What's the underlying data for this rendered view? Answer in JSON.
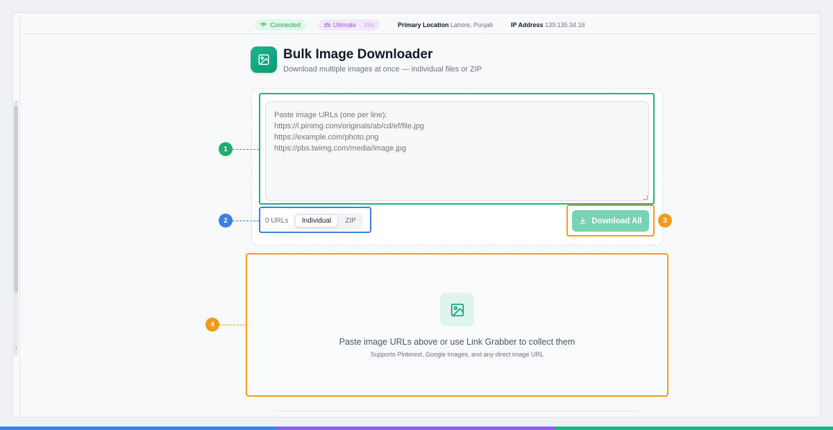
{
  "status_bar": {
    "connection": "Connected",
    "plan": "Ultimate",
    "plan_days": "39d",
    "location_label": "Primary Location",
    "location_value": "Lahore, Punjab",
    "ip_label": "IP Address",
    "ip_value": "139.135.34.16"
  },
  "header": {
    "title": "Bulk Image Downloader",
    "subtitle": "Download multiple images at once — individual files or ZIP",
    "icon": "image-icon"
  },
  "url_input": {
    "value": "",
    "placeholder": "Paste image URLs (one per line):\nhttps://i.pinimg.com/originals/ab/cd/ef/file.jpg\nhttps://example.com/photo.png\nhttps://pbs.twimg.com/media/image.jpg"
  },
  "controls": {
    "url_count": "0 URLs",
    "mode_options": [
      "Individual",
      "ZIP"
    ],
    "selected_mode": "Individual",
    "download_label": "Download All",
    "download_icon": "download-icon"
  },
  "empty_state": {
    "icon": "image-icon",
    "message": "Paste image URLs above or use Link Grabber to collect them",
    "hint": "Supports Pinterest, Google Images, and any direct image URL"
  },
  "callouts": [
    "1",
    "2",
    "3",
    "4"
  ],
  "colors": {
    "accent_green": "#12a67f",
    "callout_green": "#1fae6e",
    "callout_blue": "#3b7fe0",
    "callout_orange": "#f39a1c",
    "bottom_bar": [
      "#3b82f6",
      "#8b5cf6",
      "#10b981"
    ]
  }
}
